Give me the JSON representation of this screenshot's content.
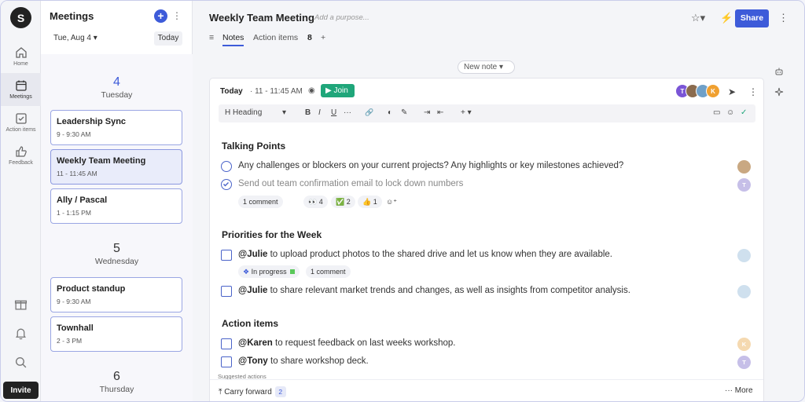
{
  "rail": {
    "logo": "S",
    "items": [
      {
        "label": "Home"
      },
      {
        "label": "Meetings"
      },
      {
        "label": "Action items"
      },
      {
        "label": "Feedback"
      }
    ],
    "invite_label": "Invite"
  },
  "meetings": {
    "title": "Meetings",
    "add_icon": "+",
    "more_icon": "⋮",
    "date": "Tue, Aug 4 ▾",
    "today_label": "Today",
    "days": [
      {
        "num": "4",
        "name": "Tuesday"
      },
      {
        "num": "5",
        "name": "Wednesday"
      },
      {
        "num": "6",
        "name": "Thursday"
      }
    ],
    "cards": [
      {
        "title": "Leadership Sync",
        "time": "9 - 9:30 AM"
      },
      {
        "title": "Weekly Team Meeting",
        "time": "11 - 11:45 AM"
      },
      {
        "title": "Ally / Pascal",
        "time": "1 - 1:15 PM"
      },
      {
        "title": "Product standup",
        "time": "9 - 9:30 AM"
      },
      {
        "title": "Townhall",
        "time": "2 - 3 PM"
      }
    ]
  },
  "header": {
    "title": "Weekly Team Meeting",
    "purpose_placeholder": "Add a purpose...",
    "share_label": "Share",
    "star_icon": "☆▾",
    "bolt_icon": "⚡",
    "more_icon": "⋮"
  },
  "tabs": {
    "list_icon": "≡",
    "notes": "Notes",
    "action_items": "Action items",
    "action_count": "8",
    "add": "+"
  },
  "new_note": "New note  ▾",
  "note": {
    "today": "Today",
    "time": "· 11 - 11:45 AM",
    "rec_icon": "◉",
    "join_label": "▶ Join",
    "avatars": [
      {
        "initial": "T",
        "color": "#7a55d6"
      },
      {
        "initial": "",
        "color": "#8a6b4e"
      },
      {
        "initial": "",
        "color": "#6fa0c8"
      },
      {
        "initial": "K",
        "color": "#f0a030"
      }
    ],
    "send_icon": "➤",
    "more_icon": "⋮",
    "toolbar": {
      "heading": "H  Heading",
      "dropdown": "▾",
      "bold": "B",
      "italic": "I",
      "underline": "U",
      "ellipsis": "···",
      "link": "🔗",
      "palette": "◐",
      "pen": "✎",
      "indent": "⇥",
      "outdent": "⇤",
      "insert": "+ ▾",
      "comment": "▭",
      "emoji": "☺",
      "check": "✓"
    },
    "sections": [
      {
        "title": "Talking Points",
        "items": [
          {
            "text": "Any challenges or blockers on your current projects? Any highlights or key milestones achieved?"
          },
          {
            "text": "Send out team confirmation email to lock down numbers"
          }
        ]
      },
      {
        "title": "Priorities for the Week",
        "items": [
          {
            "mention": "@Julie",
            "text": " to upload product photos to the shared drive and let us know when they are available."
          },
          {
            "mention": "@Julie",
            "text": " to share relevant market trends and changes, as well as insights from competitor analysis."
          }
        ]
      },
      {
        "title": "Action items",
        "items": [
          {
            "mention": "@Karen",
            "text": " to request feedback on last weeks workshop."
          },
          {
            "mention": "@Tony",
            "text": " to share workshop deck."
          }
        ]
      }
    ],
    "reactions": {
      "comment": "1 comment",
      "eyes": "👀 4",
      "check": "✅ 2",
      "thumbs": "👍 1",
      "add": "☺⁺"
    },
    "priority_meta": {
      "status": "In progress",
      "comment": "1 comment"
    },
    "row_avatars": [
      "",
      "T",
      "",
      "",
      "K",
      "T"
    ],
    "suggested_label": "Suggested actions",
    "carry_label": "⤒ Carry forward",
    "carry_count": "2",
    "more_label": "··· More"
  }
}
